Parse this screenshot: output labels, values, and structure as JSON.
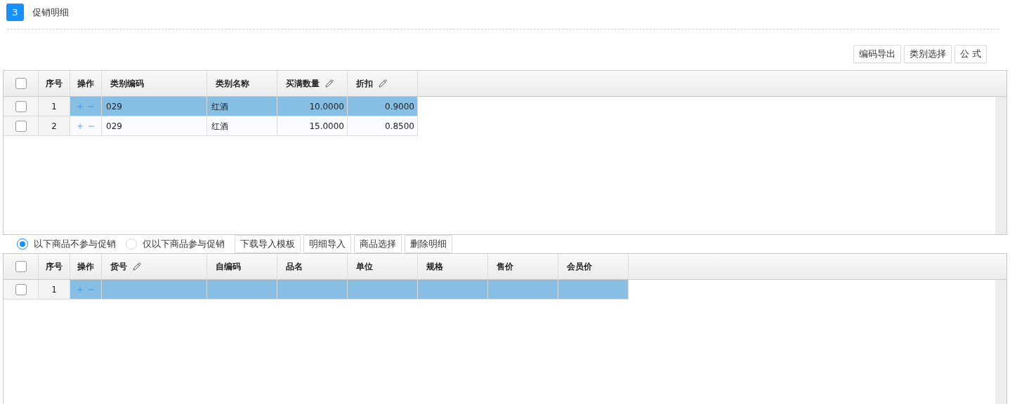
{
  "section": {
    "number": "3",
    "title": "促销明细"
  },
  "toolbar_buttons": [
    "编码导出",
    "类别选择",
    "公 式"
  ],
  "table_1": {
    "header_checked": false,
    "columns": [
      {
        "label": "序号",
        "kind": "index",
        "editable": false
      },
      {
        "label": "操作",
        "kind": "actions",
        "editable": false
      },
      {
        "label": "类别编码",
        "kind": "text",
        "editable": false
      },
      {
        "label": "类别名称",
        "kind": "text",
        "editable": false
      },
      {
        "label": "买满数量",
        "kind": "number",
        "editable": true
      },
      {
        "label": "折扣",
        "kind": "number",
        "editable": true
      }
    ],
    "rows": [
      {
        "selected": true,
        "checked": false,
        "cells": [
          "1",
          "",
          "029",
          "红酒",
          "10.0000",
          "0.9000"
        ]
      },
      {
        "selected": false,
        "checked": false,
        "cells": [
          "2",
          "",
          "029",
          "红酒",
          "15.0000",
          "0.8500"
        ]
      }
    ]
  },
  "scope_options": [
    {
      "label": "以下商品不参与促销",
      "selected": true
    },
    {
      "label": "仅以下商品参与促销",
      "selected": false
    }
  ],
  "detail_buttons": [
    "下载导入模板",
    "明细导入",
    "商品选择",
    "删除明细"
  ],
  "table_2": {
    "header_checked": false,
    "columns": [
      {
        "label": "序号",
        "kind": "index",
        "editable": false
      },
      {
        "label": "操作",
        "kind": "actions",
        "editable": false
      },
      {
        "label": "货号",
        "kind": "text",
        "editable": true
      },
      {
        "label": "自编码",
        "kind": "text",
        "editable": false
      },
      {
        "label": "品名",
        "kind": "text",
        "editable": false
      },
      {
        "label": "单位",
        "kind": "text",
        "editable": false
      },
      {
        "label": "规格",
        "kind": "text",
        "editable": false
      },
      {
        "label": "售价",
        "kind": "number",
        "editable": false
      },
      {
        "label": "会员价",
        "kind": "number",
        "editable": false
      }
    ],
    "rows": [
      {
        "selected": true,
        "checked": false,
        "cells": [
          "1",
          "",
          "",
          "",
          "",
          "",
          "",
          "",
          ""
        ]
      }
    ]
  }
}
